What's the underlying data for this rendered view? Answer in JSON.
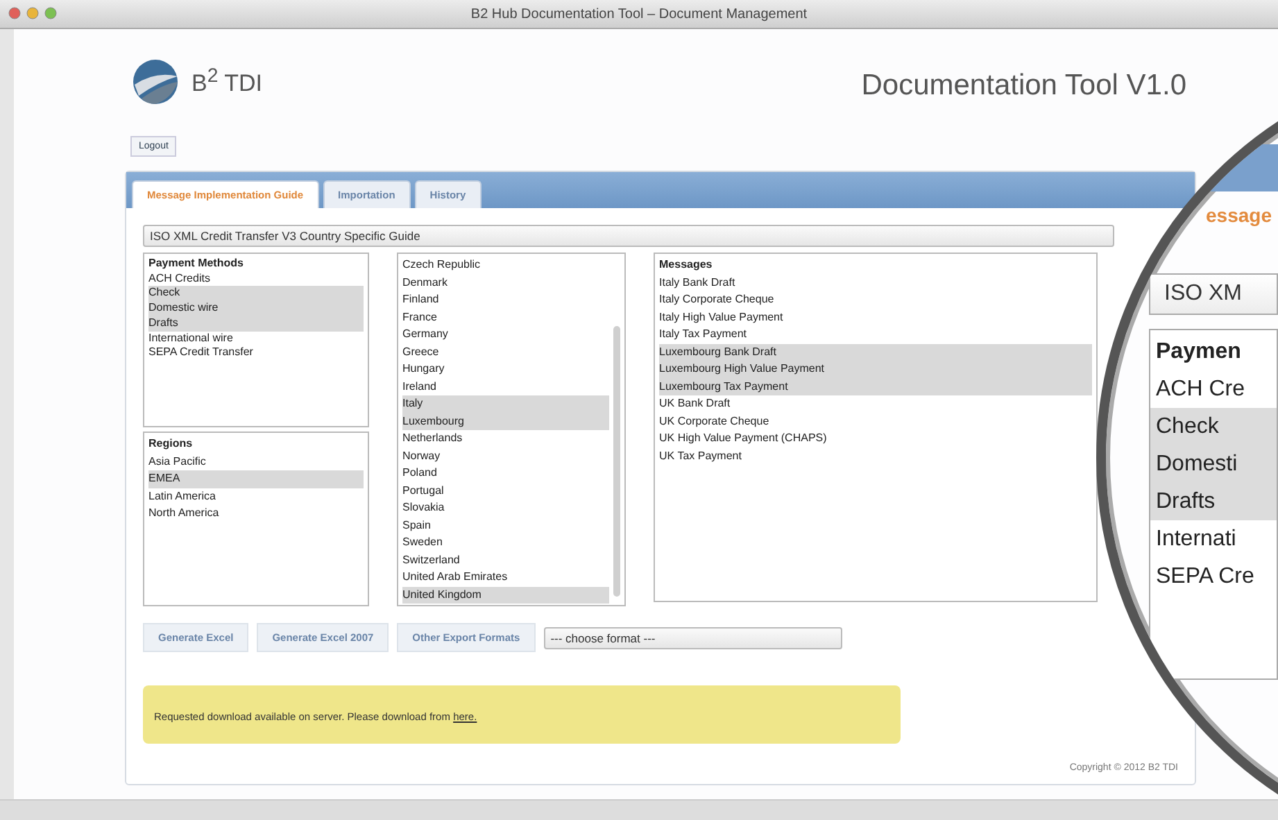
{
  "window": {
    "title": "B2 Hub Documentation Tool – Document Management"
  },
  "header": {
    "logo_text": "B$^{2}$ TDI",
    "app_title": "Documentation Tool V1.0",
    "logout": "Logout"
  },
  "tabs": [
    {
      "label": "Message Implementation Guide",
      "selected": true
    },
    {
      "label": "Importation",
      "selected": false
    },
    {
      "label": "History",
      "selected": false
    }
  ],
  "guide_select": {
    "value": "ISO XML Credit Transfer V3 Country Specific Guide"
  },
  "payment_methods": {
    "header": "Payment Methods",
    "items": [
      {
        "label": "ACH Credits",
        "selected": false
      },
      {
        "label": "Check",
        "selected": true
      },
      {
        "label": "Domestic wire",
        "selected": true
      },
      {
        "label": "Drafts",
        "selected": true
      },
      {
        "label": "International wire",
        "selected": false
      },
      {
        "label": "SEPA Credit Transfer",
        "selected": false
      }
    ]
  },
  "regions": {
    "header": "Regions",
    "items": [
      {
        "label": "Asia Pacific",
        "selected": false
      },
      {
        "label": "EMEA",
        "selected": true
      },
      {
        "label": "Latin America",
        "selected": false
      },
      {
        "label": "North America",
        "selected": false
      }
    ]
  },
  "countries": [
    {
      "label": "Czech Republic",
      "selected": false
    },
    {
      "label": "Denmark",
      "selected": false
    },
    {
      "label": "Finland",
      "selected": false
    },
    {
      "label": "France",
      "selected": false
    },
    {
      "label": "Germany",
      "selected": false
    },
    {
      "label": "Greece",
      "selected": false
    },
    {
      "label": "Hungary",
      "selected": false
    },
    {
      "label": "Ireland",
      "selected": false
    },
    {
      "label": "Italy",
      "selected": true
    },
    {
      "label": "Luxembourg",
      "selected": true
    },
    {
      "label": "Netherlands",
      "selected": false
    },
    {
      "label": "Norway",
      "selected": false
    },
    {
      "label": "Poland",
      "selected": false
    },
    {
      "label": "Portugal",
      "selected": false
    },
    {
      "label": "Slovakia",
      "selected": false
    },
    {
      "label": "Spain",
      "selected": false
    },
    {
      "label": "Sweden",
      "selected": false
    },
    {
      "label": "Switzerland",
      "selected": false
    },
    {
      "label": "United Arab Emirates",
      "selected": false
    },
    {
      "label": "United Kingdom",
      "selected": true
    }
  ],
  "messages": {
    "header": "Messages",
    "items": [
      {
        "label": "Italy Bank Draft",
        "selected": false
      },
      {
        "label": "Italy Corporate Cheque",
        "selected": false
      },
      {
        "label": "Italy High Value Payment",
        "selected": false
      },
      {
        "label": "Italy Tax Payment",
        "selected": false
      },
      {
        "label": "Luxembourg Bank Draft",
        "selected": true
      },
      {
        "label": "Luxembourg High Value Payment",
        "selected": true
      },
      {
        "label": "Luxembourg Tax Payment",
        "selected": true
      },
      {
        "label": "UK Bank Draft",
        "selected": false
      },
      {
        "label": "UK Corporate Cheque",
        "selected": false
      },
      {
        "label": "UK High Value Payment (CHAPS)",
        "selected": false
      },
      {
        "label": "UK Tax Payment",
        "selected": false
      }
    ]
  },
  "export_buttons": [
    "Generate Excel",
    "Generate Excel 2007",
    "Other Export Formats"
  ],
  "format_select": {
    "value": "--- choose format ---"
  },
  "notice": {
    "text": "Requested download available on server. Please download from",
    "link": "here."
  },
  "copyright": "Copyright © 2012 B2 TDI",
  "magnifier": {
    "tab": "essage",
    "select_value": "ISO XM",
    "list_header": "Paymen",
    "items": [
      {
        "label": "ACH Cre",
        "selected": false
      },
      {
        "label": "Check",
        "selected": true
      },
      {
        "label": "Domesti",
        "selected": true
      },
      {
        "label": "Drafts",
        "selected": true
      },
      {
        "label": "Internati",
        "selected": false
      },
      {
        "label": "SEPA Cre",
        "selected": false
      }
    ]
  }
}
